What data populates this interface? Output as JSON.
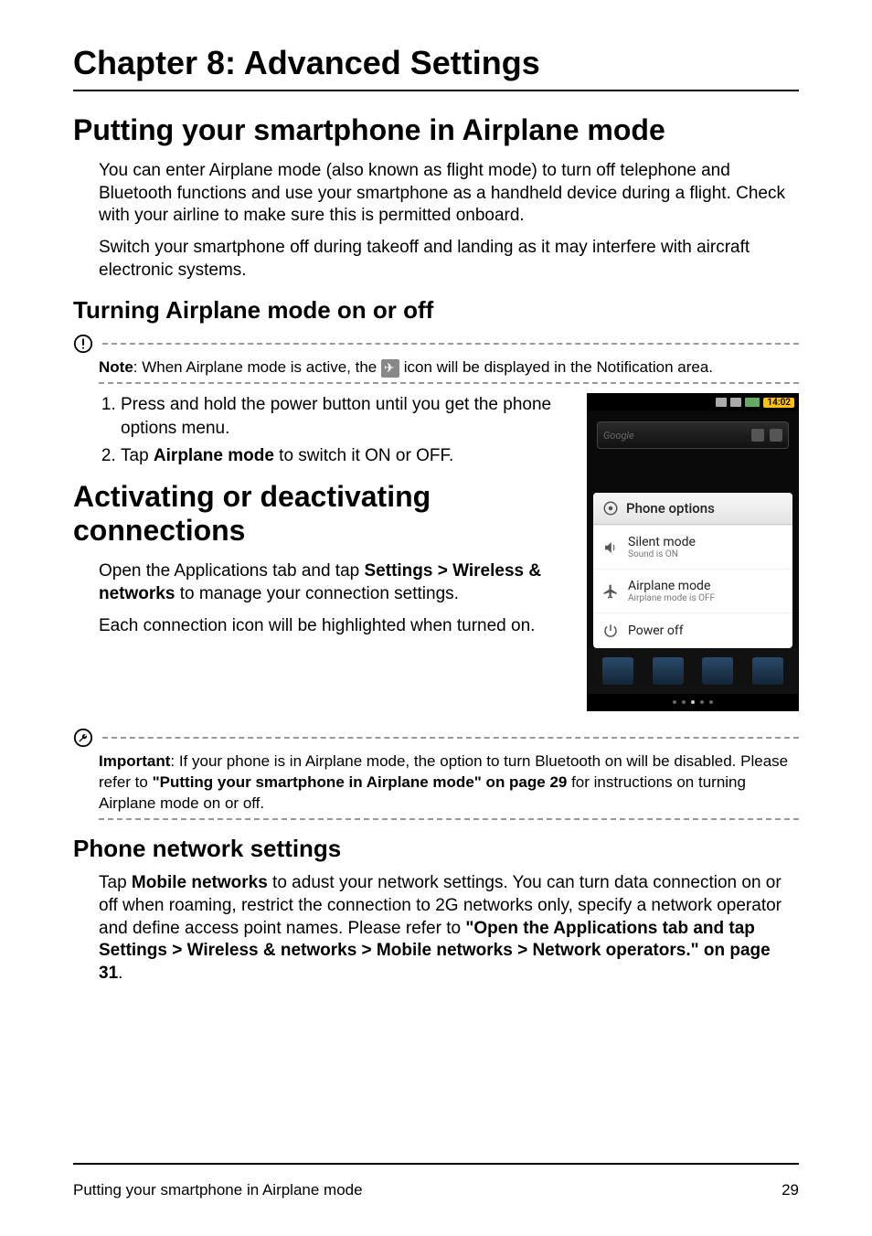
{
  "chapter_title": "Chapter 8: Advanced Settings",
  "section1": {
    "title": "Putting your smartphone in Airplane mode",
    "p1": "You can enter Airplane mode (also known as flight mode) to turn off telephone and Bluetooth functions and use your smartphone as a handheld device during a flight. Check with your airline to make sure this is permitted onboard.",
    "p2": "Switch your smartphone off during takeoff and landing as it may interfere with aircraft electronic systems."
  },
  "subsection1": {
    "title": "Turning Airplane mode on or off"
  },
  "note": {
    "label": "Note",
    "before": ": When Airplane mode is active, the ",
    "after": " icon will be displayed in the Notification area."
  },
  "steps": {
    "s1": "Press and hold the power button until you get the phone options menu.",
    "s2_a": "Tap ",
    "s2_b": "Airplane mode",
    "s2_c": " to switch it ON or OFF."
  },
  "section2": {
    "title": "Activating or deactivating connections",
    "p1_a": "Open the Applications tab and tap ",
    "p1_b": "Settings > Wireless & networks",
    "p1_c": " to manage your connection settings.",
    "p2": "Each connection icon will be highlighted when turned on."
  },
  "important": {
    "label": "Important",
    "before": ": If your phone is in Airplane mode, the option to turn Bluetooth on will be disabled. Please refer to ",
    "link": "\"Putting your smartphone in Airplane mode\" on page 29",
    "after": " for instructions on turning Airplane mode on or off."
  },
  "subsection2": {
    "title": "Phone network settings",
    "p1_a": "Tap ",
    "p1_b": "Mobile networks",
    "p1_c": " to adust your network settings. You can turn data connection on or off when roaming, restrict the connection to 2G networks only, specify a network operator and define access point names. Please refer to ",
    "p1_d": "\"Open the Applications tab and tap Settings > Wireless & networks > Mobile networks > Network operators.\" on page 31",
    "p1_e": "."
  },
  "phone": {
    "time": "14:02",
    "search_placeholder": "Google",
    "modal_title": "Phone options",
    "silent_title": "Silent mode",
    "silent_sub": "Sound is ON",
    "airplane_title": "Airplane mode",
    "airplane_sub": "Airplane mode is OFF",
    "poweroff_title": "Power off"
  },
  "footer": {
    "left": "Putting your smartphone in Airplane mode",
    "right": "29"
  }
}
